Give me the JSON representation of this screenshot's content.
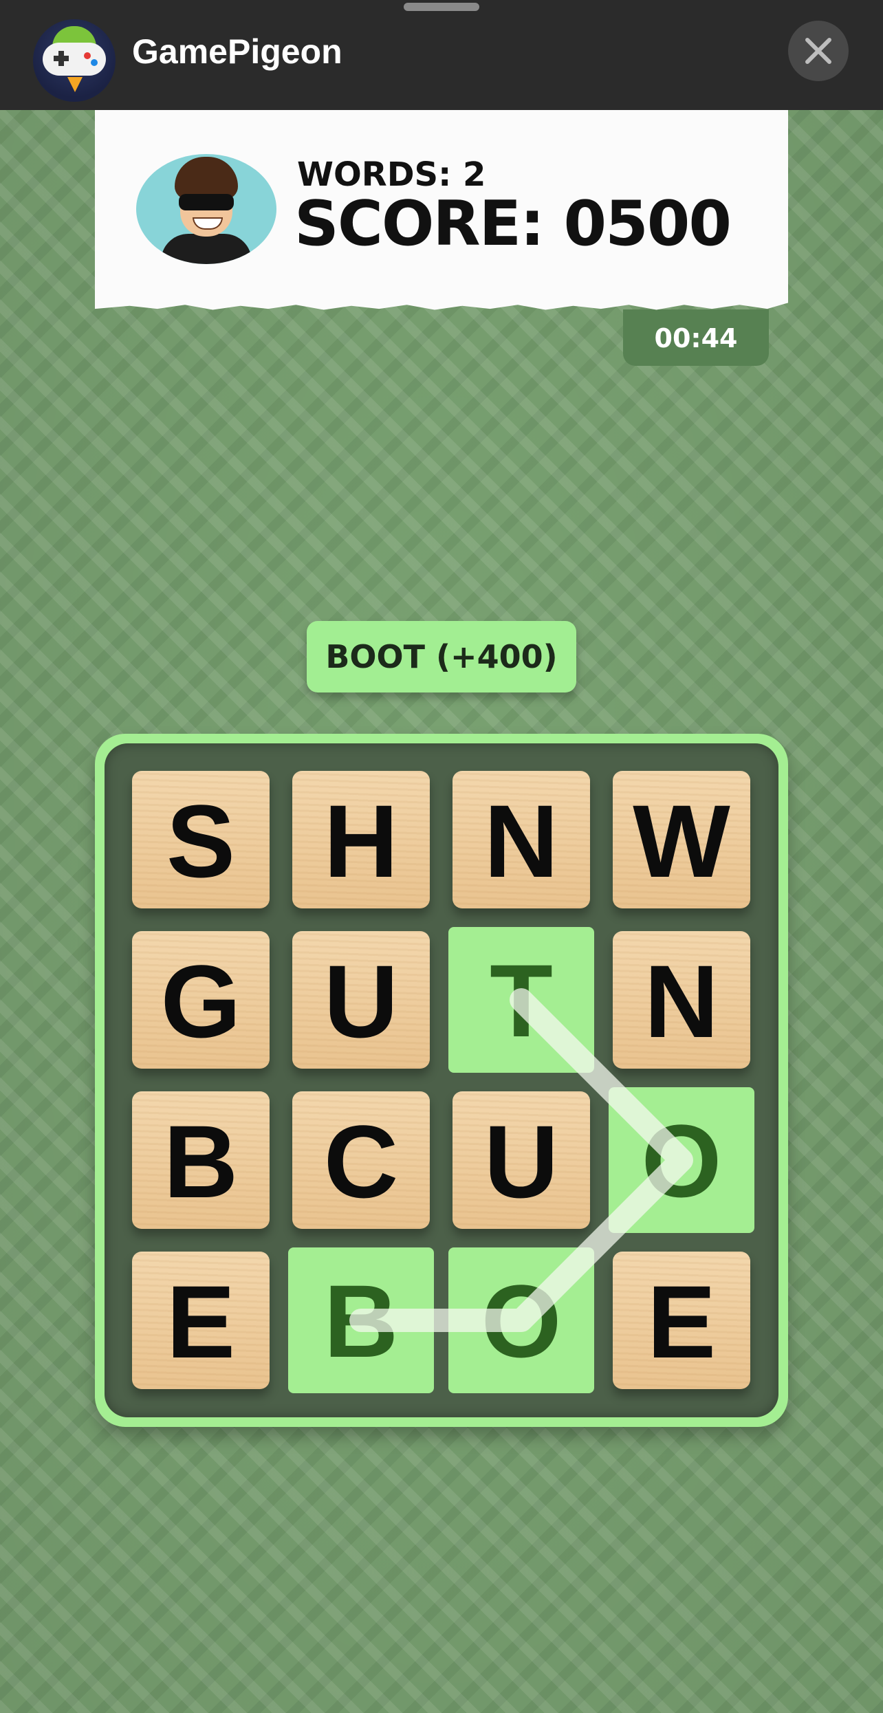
{
  "header": {
    "app_title": "GamePigeon",
    "app_icon": "gamepigeon-logo",
    "close_icon": "close-icon"
  },
  "scorecard": {
    "words_text": "WORDS: 2",
    "score_text": "SCORE: 0500"
  },
  "timer": "00:44",
  "found_word": "BOOT (+400)",
  "board": {
    "rows": [
      [
        {
          "letter": "S",
          "selected": false
        },
        {
          "letter": "H",
          "selected": false
        },
        {
          "letter": "N",
          "selected": false
        },
        {
          "letter": "W",
          "selected": false
        }
      ],
      [
        {
          "letter": "G",
          "selected": false
        },
        {
          "letter": "U",
          "selected": false
        },
        {
          "letter": "T",
          "selected": true
        },
        {
          "letter": "N",
          "selected": false
        }
      ],
      [
        {
          "letter": "B",
          "selected": false
        },
        {
          "letter": "C",
          "selected": false
        },
        {
          "letter": "U",
          "selected": false
        },
        {
          "letter": "O",
          "selected": true
        }
      ],
      [
        {
          "letter": "E",
          "selected": false
        },
        {
          "letter": "B",
          "selected": true
        },
        {
          "letter": "O",
          "selected": true
        },
        {
          "letter": "E",
          "selected": false
        }
      ]
    ],
    "selection_path": [
      [
        3,
        1
      ],
      [
        3,
        2
      ],
      [
        2,
        3
      ],
      [
        1,
        2
      ]
    ]
  },
  "colors": {
    "background": "#79a171",
    "highlight": "#a4ee92",
    "board_frame": "#4c6049",
    "tile": "#f0d2a6",
    "timer_bg": "#578152"
  }
}
